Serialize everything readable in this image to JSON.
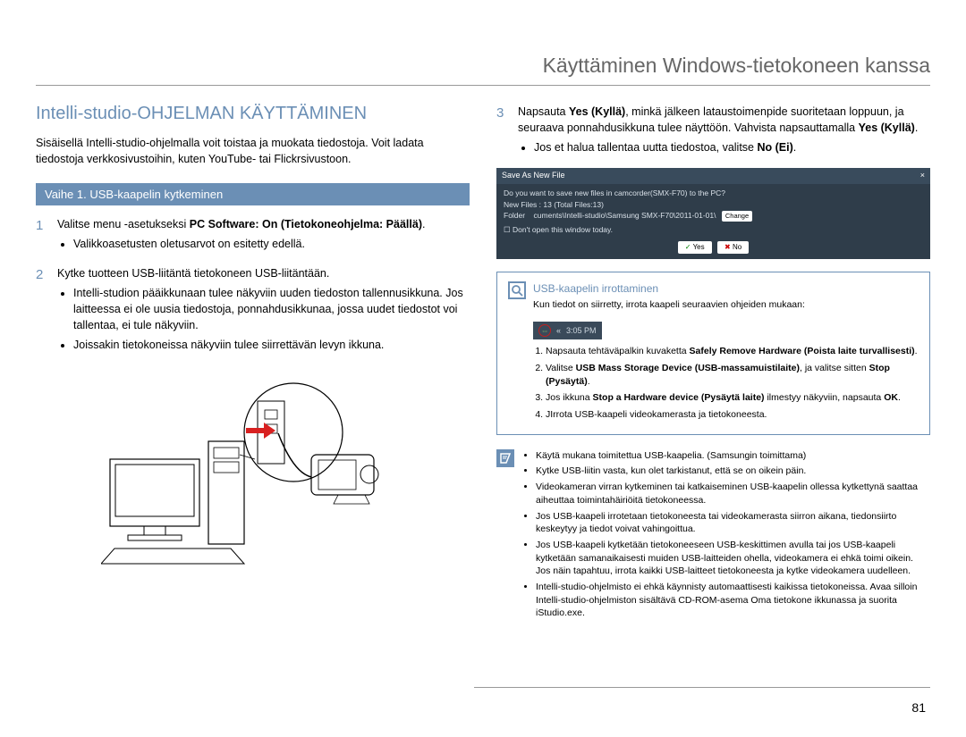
{
  "header": "Käyttäminen Windows-tietokoneen kanssa",
  "left": {
    "title": "Intelli-studio-OHJELMAN KÄYTTÄMINEN",
    "intro": "Sisäisellä Intelli-studio-ohjelmalla voit toistaa ja muokata tiedostoja. Voit ladata tiedostoja verkkosivustoihin, kuten YouTube- tai Flickrsivustoon.",
    "step_header": "Vaihe 1. USB-kaapelin kytkeminen",
    "step1": {
      "num": "1",
      "text_a": "Valitse menu -asetukseksi ",
      "text_b": "PC Software: On (Tietokoneohjelma: Päällä)",
      "text_c": ".",
      "bullet1": "Valikkoasetusten oletusarvot on esitetty edellä."
    },
    "step2": {
      "num": "2",
      "text": "Kytke tuotteen USB-liitäntä tietokoneen USB-liitäntään.",
      "bullet1": "Intelli-studion pääikkunaan tulee näkyviin uuden tiedoston tallennusikkuna. Jos laitteessa ei ole uusia tiedostoja, ponnahdusikkunaa, jossa uudet tiedostot voi tallentaa, ei tule näkyviin.",
      "bullet2": "Joissakin tietokoneissa näkyviin tulee siirrettävän levyn ikkuna."
    }
  },
  "right": {
    "step3": {
      "num": "3",
      "text_a": "Napsauta ",
      "text_b": "Yes (Kyllä)",
      "text_c": ", minkä jälkeen lataustoimenpide suoritetaan loppuun, ja seuraava ponnahdusikkuna tulee näyttöön. Vahvista napsauttamalla ",
      "text_d": "Yes (Kyllä)",
      "text_e": ".",
      "bullet_a": "Jos et halua tallentaa uutta tiedostoa, valitse ",
      "bullet_b": "No (Ei)",
      "bullet_c": "."
    },
    "dialog": {
      "title": "Save As New File",
      "line1": "Do you want to save new files in camcorder(SMX-F70) to the PC?",
      "line2a": "New Files : 13 (Total Files:13)",
      "line3a": "Folder",
      "line3b": "cuments\\Intelli-studio\\Samsung SMX-F70\\2011-01-01\\",
      "change": "Change",
      "line4": "Don't open this window today.",
      "yes": "Yes",
      "no": "No"
    },
    "info": {
      "title": "USB-kaapelin irrottaminen",
      "sub": "Kun tiedot on siirretty, irrota kaapeli seuraavien ohjeiden mukaan:",
      "time": "3:05 PM",
      "li1_a": "Napsauta tehtäväpalkin kuvaketta ",
      "li1_b": "Safely Remove Hardware (Poista laite turvallisesti)",
      "li1_c": ".",
      "li2_a": "Valitse ",
      "li2_b": "USB Mass Storage Device (USB-massamuistilaite)",
      "li2_c": ", ja valitse sitten ",
      "li2_d": "Stop (Pysäytä)",
      "li2_e": ".",
      "li3_a": "Jos ikkuna ",
      "li3_b": "Stop a Hardware device (Pysäytä laite)",
      "li3_c": " ilmestyy näkyviin, napsauta ",
      "li3_d": "OK",
      "li3_e": ".",
      "li4": "JIrrota USB-kaapeli videokamerasta ja tietokoneesta."
    },
    "notes": {
      "n1": "Käytä mukana toimitettua USB-kaapelia. (Samsungin toimittama)",
      "n2": "Kytke USB-liitin vasta, kun olet tarkistanut, että se on oikein päin.",
      "n3": "Videokameran virran kytkeminen tai katkaiseminen USB-kaapelin ollessa kytkettynä saattaa aiheuttaa toimintahäiriöitä tietokoneessa.",
      "n4": "Jos USB-kaapeli irrotetaan tietokoneesta tai videokamerasta siirron aikana, tiedonsiirto keskeytyy ja tiedot voivat vahingoittua.",
      "n5": "Jos USB-kaapeli kytketään tietokoneeseen USB-keskittimen avulla tai jos USB-kaapeli kytketään samanaikaisesti muiden USB-laitteiden ohella, videokamera ei ehkä toimi oikein. Jos näin tapahtuu, irrota kaikki USB-laitteet tietokoneesta ja kytke videokamera uudelleen.",
      "n6": "Intelli-studio-ohjelmisto ei ehkä käynnisty automaattisesti kaikissa tietokoneissa. Avaa silloin Intelli-studio-ohjelmiston sisältävä CD-ROM-asema Oma tietokone ikkunassa ja suorita iStudio.exe."
    }
  },
  "page_num": "81"
}
